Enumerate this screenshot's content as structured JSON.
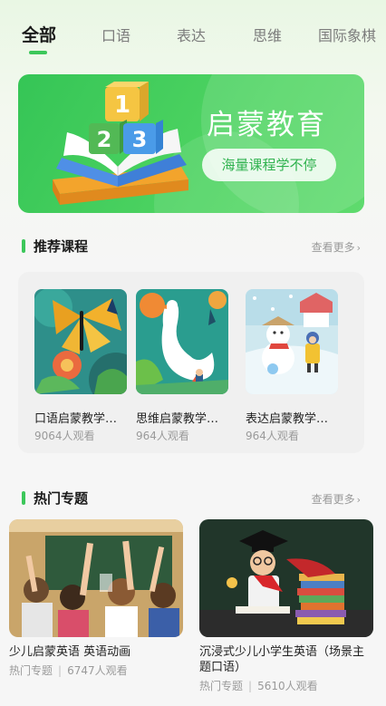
{
  "tabs": [
    {
      "label": "全部",
      "active": true
    },
    {
      "label": "口语",
      "active": false
    },
    {
      "label": "表达",
      "active": false
    },
    {
      "label": "思维",
      "active": false
    },
    {
      "label": "国际象棋",
      "active": false
    }
  ],
  "banner": {
    "title": "启蒙教育",
    "button_label": "海量课程学不停",
    "art_numbers": [
      "1",
      "2",
      "3"
    ]
  },
  "recommended": {
    "title": "推荐课程",
    "more_label": "查看更多",
    "items": [
      {
        "title": "口语启蒙教学…",
        "views": "9064人观看"
      },
      {
        "title": "思维启蒙教学…",
        "views": "964人观看"
      },
      {
        "title": "表达启蒙教学…",
        "views": "964人观看"
      }
    ]
  },
  "hot_topics": {
    "title": "热门专题",
    "more_label": "查看更多",
    "items": [
      {
        "title": "少儿启蒙英语 英语动画",
        "tag": "热门专题",
        "views": "6747人观看"
      },
      {
        "title": "沉浸式少儿小学生英语（场景主题口语）",
        "tag": "热门专题",
        "views": "5610人观看"
      }
    ]
  },
  "colors": {
    "accent": "#3cc75a",
    "banner_green": "#40cc5c"
  },
  "icons": {
    "more_arrow": "chevron-right-icon"
  }
}
